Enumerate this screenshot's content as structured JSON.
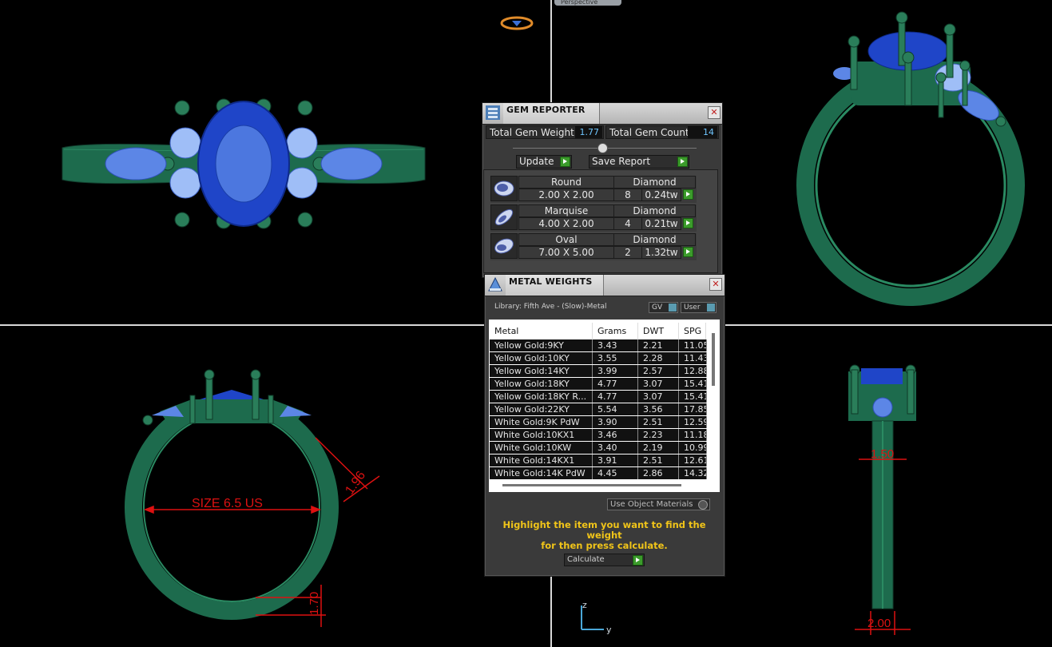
{
  "viewport": {
    "perspective_label": "Perspective",
    "axis_z": "z",
    "axis_y": "y"
  },
  "dimensions": {
    "size_label": "SIZE 6.5 US",
    "side_width": "1.96",
    "bottom_thickness": "1.70",
    "shank_width_top": "1.50",
    "shank_width_bottom": "2.00"
  },
  "gem_reporter": {
    "title": "GEM REPORTER",
    "total_weight_label": "Total Gem Weight",
    "total_weight_value": "1.77",
    "total_count_label": "Total Gem Count",
    "total_count_value": "14",
    "update_label": "Update",
    "save_report_label": "Save Report",
    "gems": [
      {
        "shape": "Round",
        "type": "Diamond",
        "size": "2.00 X 2.00",
        "count": "8",
        "weight": "0.24tw"
      },
      {
        "shape": "Marquise",
        "type": "Diamond",
        "size": "4.00 X 2.00",
        "count": "4",
        "weight": "0.21tw"
      },
      {
        "shape": "Oval",
        "type": "Diamond",
        "size": "7.00 X 5.00",
        "count": "2",
        "weight": "1.32tw"
      }
    ]
  },
  "metal_weights": {
    "title": "METAL WEIGHTS",
    "library": "Library: Fifth Ave - (Slow)-Metal",
    "gv_label": "GV",
    "user_label": "User",
    "columns": [
      "Metal",
      "Grams",
      "DWT",
      "SPG"
    ],
    "rows": [
      [
        "Yellow Gold:9KY",
        "3.43",
        "2.21",
        "11.05"
      ],
      [
        "Yellow Gold:10KY",
        "3.55",
        "2.28",
        "11.43"
      ],
      [
        "Yellow Gold:14KY",
        "3.99",
        "2.57",
        "12.88"
      ],
      [
        "Yellow Gold:18KY",
        "4.77",
        "3.07",
        "15.41"
      ],
      [
        "Yellow Gold:18KY R...",
        "4.77",
        "3.07",
        "15.41"
      ],
      [
        "Yellow Gold:22KY",
        "5.54",
        "3.56",
        "17.85"
      ],
      [
        "White Gold:9K PdW",
        "3.90",
        "2.51",
        "12.59"
      ],
      [
        "White Gold:10KX1",
        "3.46",
        "2.23",
        "11.18"
      ],
      [
        "White Gold:10KW",
        "3.40",
        "2.19",
        "10.99"
      ],
      [
        "White Gold:14KX1",
        "3.91",
        "2.51",
        "12.61"
      ],
      [
        "White Gold:14K PdW",
        "4.45",
        "2.86",
        "14.32"
      ]
    ],
    "use_object_materials_label": "Use Object Materials",
    "hint_line1": "Highlight the item you want to find the weight",
    "hint_line2": "for then press calculate.",
    "calculate_label": "Calculate"
  }
}
